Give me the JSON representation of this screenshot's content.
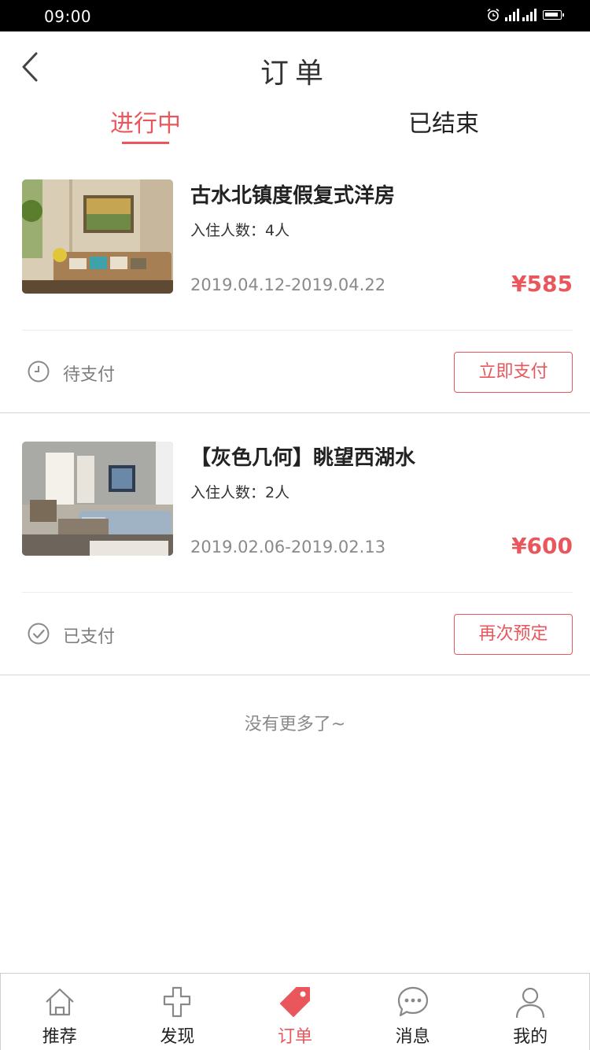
{
  "status_bar": {
    "time": "09:00"
  },
  "header": {
    "title": "订单"
  },
  "tabs": [
    {
      "label": "进行中",
      "active": true
    },
    {
      "label": "已结束",
      "active": false
    }
  ],
  "orders": [
    {
      "title": "古水北镇度假复式洋房",
      "guests": "入住人数：4人",
      "dates": "2019.04.12-2019.04.22",
      "price": "¥585",
      "status": "待支付",
      "status_icon": "clock-icon",
      "action": "立即支付"
    },
    {
      "title": "【灰色几何】眺望西湖水",
      "guests": "入住人数：2人",
      "dates": "2019.02.06-2019.02.13",
      "price": "¥600",
      "status": "已支付",
      "status_icon": "check-circle-icon",
      "action": "再次预定"
    }
  ],
  "footer_note": "没有更多了~",
  "bottom_nav": [
    {
      "label": "推荐",
      "icon": "home-icon",
      "active": false
    },
    {
      "label": "发现",
      "icon": "cross-icon",
      "active": false
    },
    {
      "label": "订单",
      "icon": "tag-icon",
      "active": true
    },
    {
      "label": "消息",
      "icon": "chat-icon",
      "active": false
    },
    {
      "label": "我的",
      "icon": "user-icon",
      "active": false
    }
  ],
  "colors": {
    "accent": "#e9575d",
    "text_dark": "#222222",
    "text_muted": "#8a8a8a"
  }
}
